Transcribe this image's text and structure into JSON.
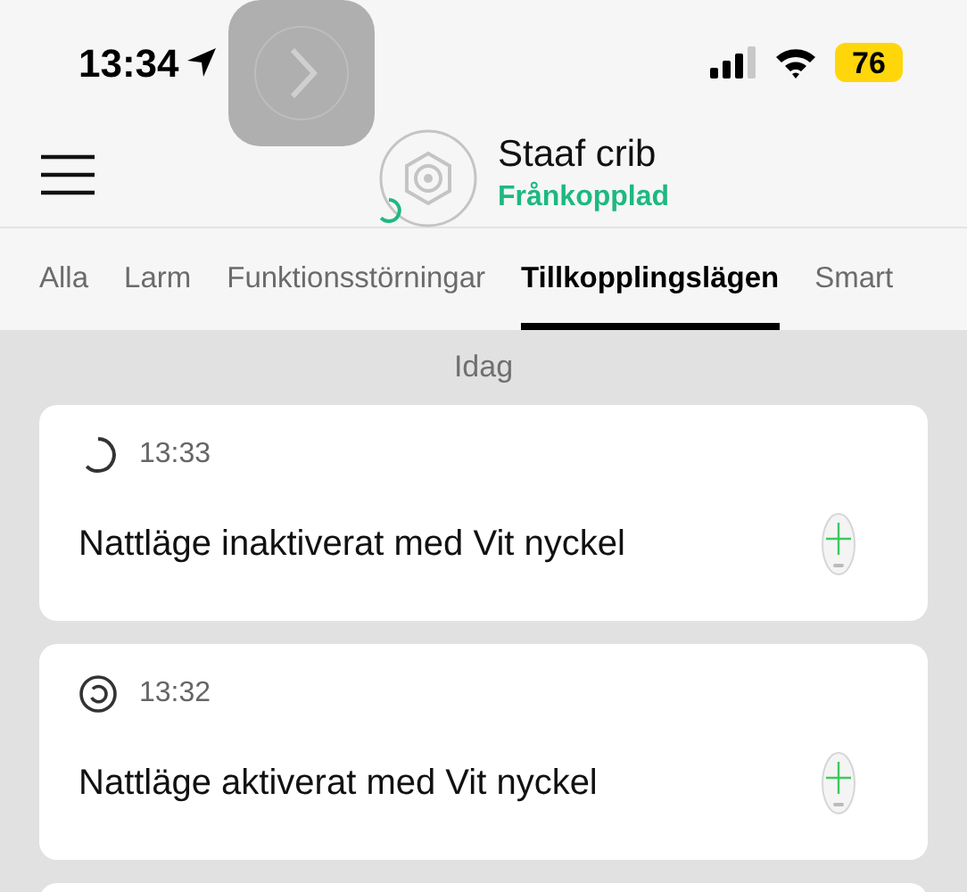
{
  "status_bar": {
    "time": "13:34",
    "battery": "76"
  },
  "header": {
    "title": "Staaf crib",
    "status": "Frånkopplad"
  },
  "tabs": [
    {
      "label": "Alla",
      "selected": false
    },
    {
      "label": "Larm",
      "selected": false
    },
    {
      "label": "Funktionsstörningar",
      "selected": false
    },
    {
      "label": "Tillkopplingslägen",
      "selected": true
    },
    {
      "label": "Smart",
      "selected": false
    }
  ],
  "day": "Idag",
  "events": [
    {
      "kind": "deactivated",
      "time": "13:33",
      "text": "Nattläge inaktiverat med Vit nyckel"
    },
    {
      "kind": "activated",
      "time": "13:32",
      "text": "Nattläge aktiverat med Vit nyckel"
    }
  ]
}
